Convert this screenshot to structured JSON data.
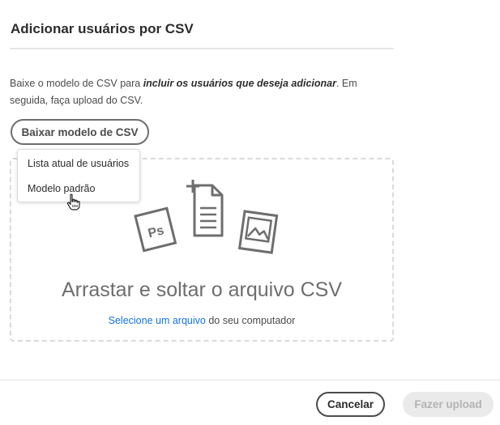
{
  "dialog": {
    "title": "Adicionar usuários por CSV"
  },
  "description": {
    "part1": "Baixe o modelo de CSV para ",
    "emphasis": "incluir os usuários que deseja adicionar",
    "part2": ". Em seguida, faça upload do CSV."
  },
  "download_button": {
    "label": "Baixar modelo de CSV"
  },
  "dropdown_menu": {
    "items": [
      {
        "label": "Lista atual de usuários"
      },
      {
        "label": "Modelo padrão"
      }
    ]
  },
  "dropzone": {
    "title": "Arrastar e soltar o arquivo CSV",
    "link_text": "Selecione um arquivo",
    "suffix_text": " do seu computador",
    "illustration_icons": [
      "photoshop-file-icon",
      "add-document-icon",
      "image-file-icon"
    ],
    "illustration_ps_text": "Ps"
  },
  "footer": {
    "cancel_label": "Cancelar",
    "upload_label": "Fazer upload",
    "upload_disabled": true
  },
  "colors": {
    "link": "#1473e6",
    "text": "#2c2c2c",
    "disabled_bg": "#eaeaea",
    "disabled_text": "#b3b3b3"
  }
}
